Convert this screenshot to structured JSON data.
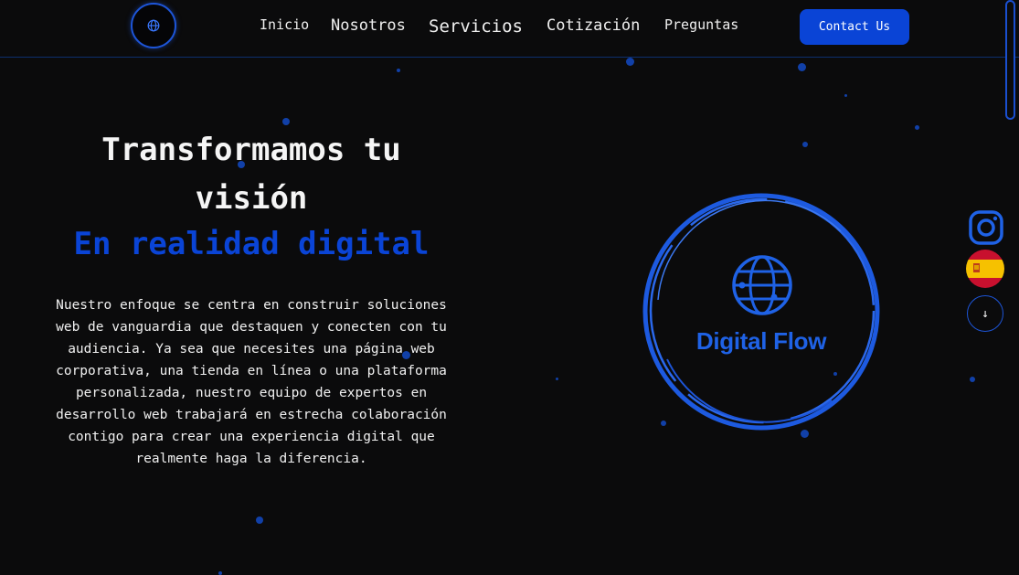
{
  "nav": {
    "items": [
      "Inicio",
      "Nosotros",
      "Servicios",
      "Cotización",
      "Preguntas"
    ],
    "contact_label": "Contact Us"
  },
  "hero": {
    "title": "Transformamos tu visión",
    "subtitle": "En realidad digital",
    "description": "Nuestro enfoque se centra en construir soluciones web de vanguardia que destaquen y conecten con tu audiencia. Ya sea que necesites una página web corporativa, una tienda en línea o una plataforma personalizada, nuestro equipo de expertos en desarrollo web trabajará en estrecha colaboración contigo para crear una experiencia digital que realmente haga la diferencia."
  },
  "brand": {
    "name": "Digital Flow"
  },
  "side": {
    "icons": [
      "instagram-icon",
      "spain-flag-icon",
      "arrow-down-icon"
    ],
    "down_arrow": "↓"
  },
  "colors": {
    "background": "#0b0b0c",
    "accent": "#0a44d6",
    "brand": "#1f62e6",
    "text": "#f2f2f2"
  }
}
